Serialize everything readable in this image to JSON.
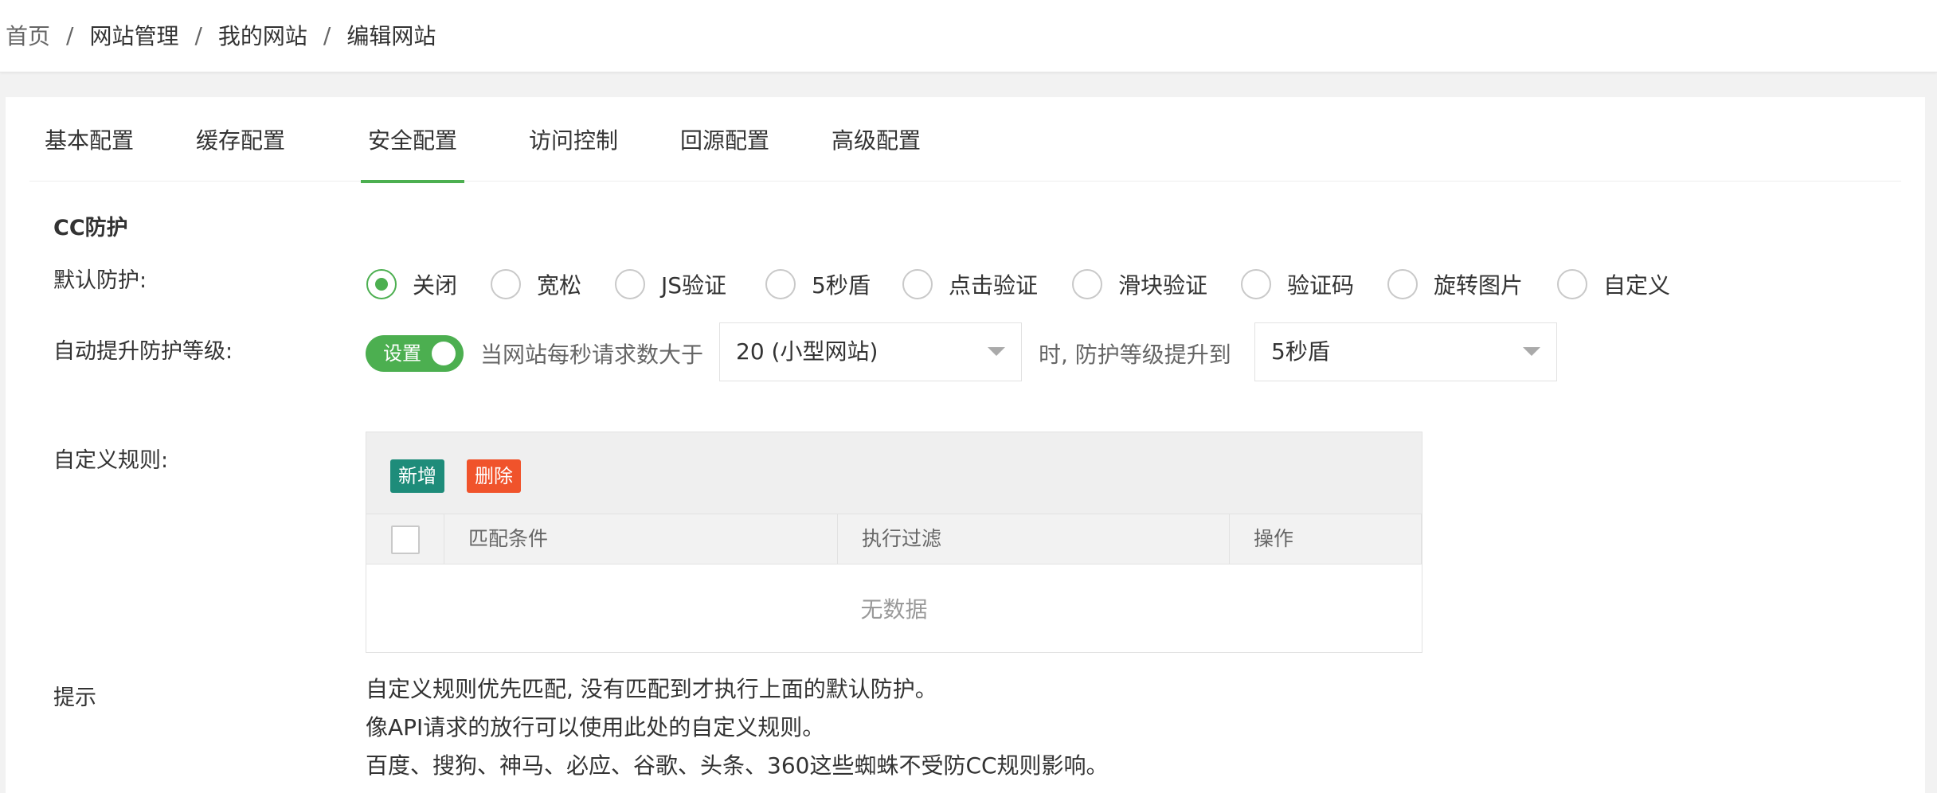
{
  "breadcrumb": {
    "items": [
      "首页",
      "网站管理",
      "我的网站",
      "编辑网站"
    ],
    "separator": "/"
  },
  "tabs": [
    {
      "label": "基本配置",
      "active": false
    },
    {
      "label": "缓存配置",
      "active": false
    },
    {
      "label": "安全配置",
      "active": true
    },
    {
      "label": "访问控制",
      "active": false
    },
    {
      "label": "回源配置",
      "active": false
    },
    {
      "label": "高级配置",
      "active": false
    }
  ],
  "cc": {
    "section_title": "CC防护",
    "default_label": "默认防护:",
    "options": [
      "关闭",
      "宽松",
      "JS验证",
      "5秒盾",
      "点击验证",
      "滑块验证",
      "验证码",
      "旋转图片",
      "自定义"
    ],
    "selected": "关闭",
    "auto_label": "自动提升防护等级:",
    "switch_label": "设置",
    "switch_on": true,
    "when_text": "当网站每秒请求数大于",
    "threshold_value": "20 (小型网站)",
    "then_text": "时, 防护等级提升到",
    "level_value": "5秒盾"
  },
  "rules": {
    "label": "自定义规则:",
    "add_button": "新增",
    "delete_button": "删除",
    "columns": [
      "匹配条件",
      "执行过滤",
      "操作"
    ],
    "empty_text": "无数据"
  },
  "tips": {
    "label": "提示",
    "lines": [
      "自定义规则优先匹配, 没有匹配到才执行上面的默认防护。",
      "像API请求的放行可以使用此处的自定义规则。",
      "百度、搜狗、神马、必应、谷歌、头条、360这些蜘蛛不受防CC规则影响。"
    ]
  },
  "colors": {
    "accent": "#4caf50",
    "add_button": "#1e8c7a",
    "delete_button": "#f0532b"
  },
  "icons": {
    "select_caret": "caret-down-icon"
  }
}
